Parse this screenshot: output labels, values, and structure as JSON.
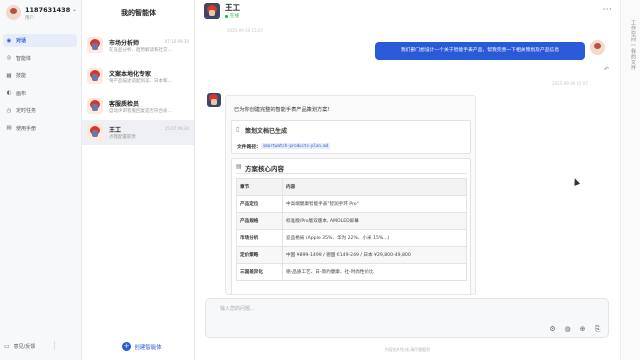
{
  "nav": {
    "user": {
      "name": "1187631438",
      "role": "用户"
    },
    "items": [
      {
        "icon": "chat-icon",
        "glyph": "◉",
        "label": "对话",
        "active": true
      },
      {
        "icon": "agent-icon",
        "glyph": "◎",
        "label": "智能体",
        "active": false
      },
      {
        "icon": "skill-icon",
        "glyph": "▦",
        "label": "技能",
        "active": false
      },
      {
        "icon": "canvas-icon",
        "glyph": "◐",
        "label": "画布",
        "active": false
      },
      {
        "icon": "task-icon",
        "glyph": "◷",
        "label": "定时任务",
        "active": false
      },
      {
        "icon": "manual-icon",
        "glyph": "▤",
        "label": "使用手册",
        "active": false
      }
    ],
    "bottom_label": "意见/反馈"
  },
  "agents": {
    "title": "我的智能体",
    "list": [
      {
        "name": "市场分析师",
        "desc": "在竞品分析、趋势解读和社交...",
        "time": "07:10 09.30",
        "selected": false
      },
      {
        "name": "文案本地化专家",
        "desc": "将产品描述适配到美、日本和...",
        "time": "",
        "selected": false
      },
      {
        "name": "客服质检员",
        "desc": "自动评审客服回复是否符合表...",
        "time": "",
        "selected": false
      },
      {
        "name": "王工",
        "desc": "点我配置职责",
        "time": "15:07 09.30",
        "selected": true
      }
    ],
    "create_label": "创建智能体"
  },
  "chat": {
    "header": {
      "name": "王工",
      "status": "在线"
    },
    "timestamp_top": "2025-09-30 15:07",
    "user_message": "我们部门想设计一个关于智能手表产品，帮我完善一下相关策划及产品信息",
    "timestamp_user": "2025-09-30 15:07",
    "bot": {
      "intro": "已为你创建完整的智能手表产品策划方案!",
      "doc_title": "策划文档已生成",
      "path_label": "文件路径:",
      "path": "smartwatch-products-plan.md",
      "plan_title": "方案核心内容",
      "table": {
        "headers": [
          "章节",
          "内容"
        ],
        "rows": [
          [
            "产品定位",
            "中高端健康智能手表\"智润手环 Pro\""
          ],
          [
            "产品规格",
            "标准版/Pro版双版本, AMOLED屏幕"
          ],
          [
            "市场分析",
            "竞品格局 (Apple 35%、华为 22%、小米 15%...)"
          ],
          [
            "定价策略",
            "中国 ¥899-1499 / 德国 €149-249 / 日本 ¥29,800-49,800"
          ],
          [
            "三国差异化",
            "德-品质工艺、日-简约健康、社-时尚性价比"
          ]
        ]
      }
    },
    "input": {
      "placeholder": "输入您的问题..."
    },
    "footer_note": "内容由AI生成,请仔细甄别"
  },
  "rail": {
    "label": "工作空间 | 我的文件"
  }
}
